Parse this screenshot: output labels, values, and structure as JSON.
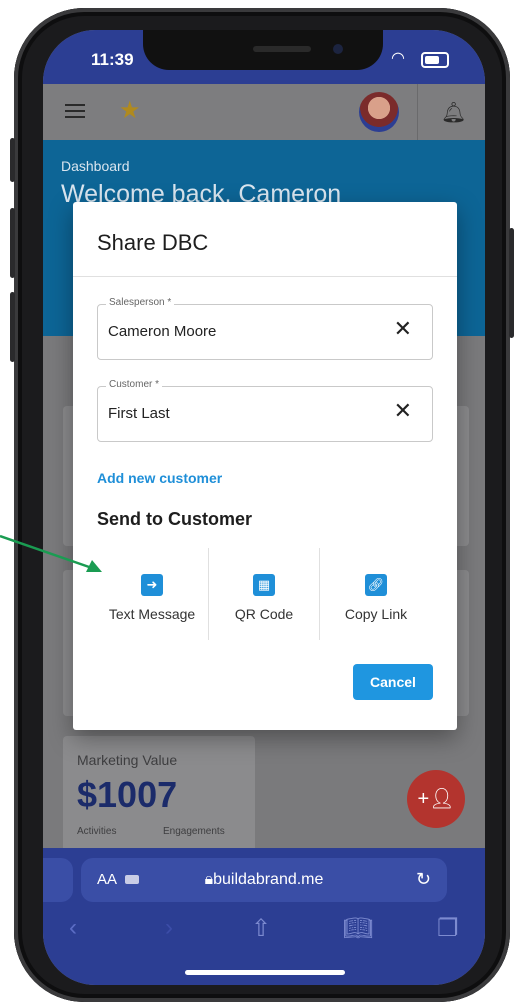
{
  "status_bar": {
    "time": "11:39"
  },
  "dashboard": {
    "label": "Dashboard",
    "welcome": "Welcome back, Cameron",
    "marketing_value_title": "Marketing Value",
    "marketing_value": "$1007",
    "activities_label": "Activities",
    "engagements_label": "Engagements"
  },
  "modal": {
    "title": "Share DBC",
    "salesperson": {
      "label": "Salesperson *",
      "value": "Cameron Moore"
    },
    "customer": {
      "label": "Customer *",
      "value": "First Last"
    },
    "add_customer_link": "Add new customer",
    "send_title": "Send to Customer",
    "options": [
      {
        "label": "Text Message",
        "icon": "arrow-forward-icon"
      },
      {
        "label": "QR Code",
        "icon": "qr-code-icon"
      },
      {
        "label": "Copy Link",
        "icon": "link-icon"
      }
    ],
    "cancel_label": "Cancel",
    "clear_glyph": "✕"
  },
  "browser": {
    "aa_label": "AA",
    "url": "buildabrand.me"
  },
  "colors": {
    "accent": "#1f96e0",
    "brand_blue": "#2c3e93",
    "annotation_arrow": "#1a9c52"
  }
}
